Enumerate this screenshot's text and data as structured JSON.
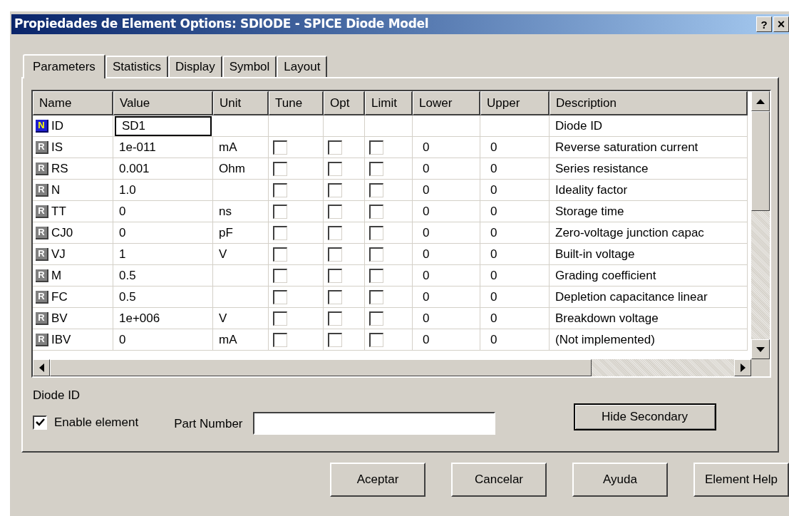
{
  "window": {
    "title": "Propiedades de Element Options: SDIODE - SPICE Diode Model",
    "help_button": "?",
    "close_button": "×"
  },
  "tabs": [
    {
      "label": "Parameters",
      "selected": true
    },
    {
      "label": "Statistics",
      "selected": false
    },
    {
      "label": "Display",
      "selected": false
    },
    {
      "label": "Symbol",
      "selected": false
    },
    {
      "label": "Layout",
      "selected": false
    }
  ],
  "table": {
    "columns": [
      "Name",
      "Value",
      "Unit",
      "Tune",
      "Opt",
      "Limit",
      "Lower",
      "Upper",
      "Description"
    ],
    "rows": [
      {
        "kind": "string",
        "badge": "N",
        "name": "ID",
        "value": "SD1",
        "editing": true,
        "description": "Diode ID"
      },
      {
        "kind": "real",
        "badge": "R",
        "name": "IS",
        "value": "1e-011",
        "editing": false,
        "unit": "mA",
        "tune": false,
        "opt": false,
        "limit": false,
        "lower": "0",
        "upper": "0",
        "description": "Reverse saturation current"
      },
      {
        "kind": "real",
        "badge": "R",
        "name": "RS",
        "value": "0.001",
        "editing": false,
        "unit": "Ohm",
        "tune": false,
        "opt": false,
        "limit": false,
        "lower": "0",
        "upper": "0",
        "description": "Series resistance"
      },
      {
        "kind": "real",
        "badge": "R",
        "name": "N",
        "value": "1.0",
        "editing": false,
        "tune": false,
        "opt": false,
        "limit": false,
        "lower": "0",
        "upper": "0",
        "description": "Ideality factor"
      },
      {
        "kind": "real",
        "badge": "R",
        "name": "TT",
        "value": "0",
        "editing": false,
        "unit": "ns",
        "tune": false,
        "opt": false,
        "limit": false,
        "lower": "0",
        "upper": "0",
        "description": "Storage time"
      },
      {
        "kind": "real",
        "badge": "R",
        "name": "CJ0",
        "value": "0",
        "editing": false,
        "unit": "pF",
        "tune": false,
        "opt": false,
        "limit": false,
        "lower": "0",
        "upper": "0",
        "description": "Zero-voltage junction capac"
      },
      {
        "kind": "real",
        "badge": "R",
        "name": "VJ",
        "value": "1",
        "editing": false,
        "unit": "V",
        "tune": false,
        "opt": false,
        "limit": false,
        "lower": "0",
        "upper": "0",
        "description": "Built-in voltage"
      },
      {
        "kind": "real",
        "badge": "R",
        "name": "M",
        "value": "0.5",
        "editing": false,
        "tune": false,
        "opt": false,
        "limit": false,
        "lower": "0",
        "upper": "0",
        "description": "Grading coefficient"
      },
      {
        "kind": "real",
        "badge": "R",
        "name": "FC",
        "value": "0.5",
        "editing": false,
        "tune": false,
        "opt": false,
        "limit": false,
        "lower": "0",
        "upper": "0",
        "description": "Depletion capacitance linear"
      },
      {
        "kind": "real",
        "badge": "R",
        "name": "BV",
        "value": "1e+006",
        "editing": false,
        "unit": "V",
        "tune": false,
        "opt": false,
        "limit": false,
        "lower": "0",
        "upper": "0",
        "description": "Breakdown voltage"
      },
      {
        "kind": "real",
        "badge": "R",
        "name": "IBV",
        "value": "0",
        "editing": false,
        "unit": "mA",
        "tune": false,
        "opt": false,
        "limit": false,
        "lower": "0",
        "upper": "0",
        "description": "(Not implemented)"
      }
    ]
  },
  "selected_description": "Diode ID",
  "enable_element": {
    "label": "Enable element",
    "checked": true
  },
  "part_number": {
    "label": "Part Number"
  },
  "hide_secondary_button": "Hide Secondary",
  "buttons": [
    "Aceptar",
    "Cancelar",
    "Ayuda",
    "Element Help"
  ]
}
